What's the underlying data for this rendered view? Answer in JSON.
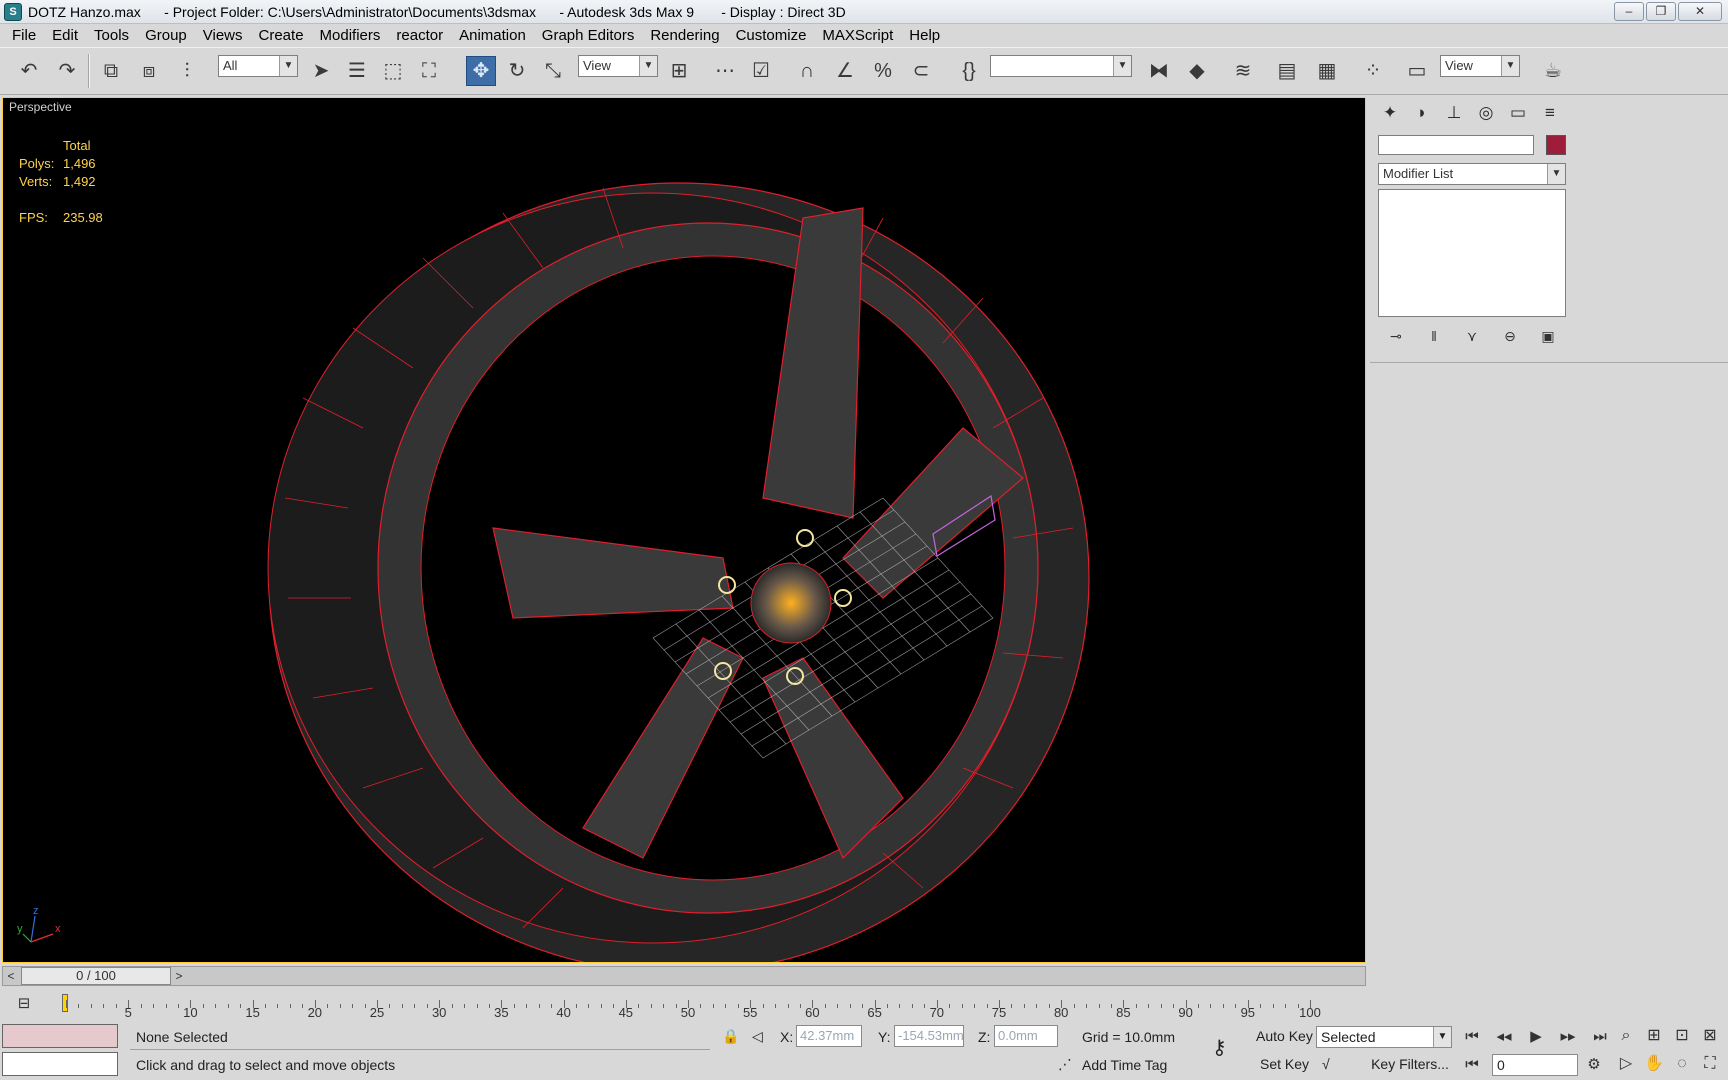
{
  "window": {
    "title": "DOTZ Hanzo.max      - Project Folder: C:\\Users\\Administrator\\Documents\\3dsmax      - Autodesk 3ds Max 9       - Display : Direct 3D",
    "minimize": "–",
    "restore": "❐",
    "close": "✕"
  },
  "menu": [
    "File",
    "Edit",
    "Tools",
    "Group",
    "Views",
    "Create",
    "Modifiers",
    "reactor",
    "Animation",
    "Graph Editors",
    "Rendering",
    "Customize",
    "MAXScript",
    "Help"
  ],
  "toolbar": {
    "selection_filter": "All",
    "ref_coord_system": "View",
    "named_selection": "",
    "view_dropdown": "View"
  },
  "viewport": {
    "label": "Perspective",
    "stats_header": "Total",
    "polys_label": "Polys:",
    "polys": "1,496",
    "verts_label": "Verts:",
    "verts": "1,492",
    "fps_label": "FPS:",
    "fps": "235.98",
    "axis_y": "y",
    "axis_z": "z",
    "axis_x": "x"
  },
  "command_panel": {
    "object_name": "",
    "object_color": "#9e1d3a",
    "modifier_list": "Modifier List"
  },
  "time_slider": {
    "frame": "0 / 100",
    "prev": "<",
    "next": ">"
  },
  "track_bar": {
    "ticks": [
      "5",
      "10",
      "15",
      "20",
      "25",
      "30",
      "35",
      "40",
      "45",
      "50",
      "55",
      "60",
      "65",
      "70",
      "75",
      "80",
      "85",
      "90",
      "95",
      "100"
    ]
  },
  "status": {
    "selection": "None Selected",
    "prompt": "Click and drag to select and move objects",
    "x_label": "X:",
    "x_value": "42.37mm",
    "y_label": "Y:",
    "y_value": "-154.53mm",
    "z_label": "Z:",
    "z_value": "0.0mm",
    "grid": "Grid = 10.0mm",
    "add_time_tag": "Add Time Tag",
    "auto_key": "Auto Key",
    "set_key": "Set Key",
    "key_mode": "Selected",
    "key_filters": "Key Filters...",
    "current_frame": "0"
  },
  "colors": {
    "wire": "#e01f2b",
    "viewport_bg": "#000000",
    "active_border": "#ffcc33",
    "stats_text": "#ffd34d"
  }
}
